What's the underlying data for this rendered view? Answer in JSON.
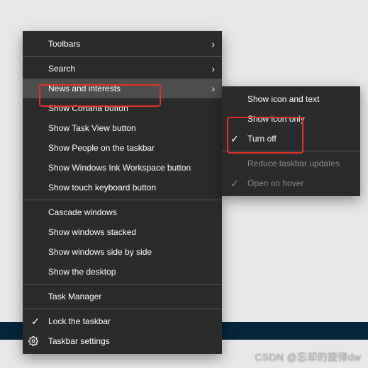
{
  "mainMenu": {
    "toolbars": "Toolbars",
    "search": "Search",
    "newsInterests": "News and interests",
    "showCortana": "Show Cortana button",
    "showTaskView": "Show Task View button",
    "showPeople": "Show People on the taskbar",
    "showInk": "Show Windows Ink Workspace button",
    "showTouchKb": "Show touch keyboard button",
    "cascade": "Cascade windows",
    "stacked": "Show windows stacked",
    "sideBySide": "Show windows side by side",
    "showDesktop": "Show the desktop",
    "taskManager": "Task Manager",
    "lockTaskbar": "Lock the taskbar",
    "taskbarSettings": "Taskbar settings"
  },
  "subMenu": {
    "iconText": "Show icon and text",
    "iconOnly": "Show icon only",
    "turnOff": "Turn off",
    "reduceUpdates": "Reduce taskbar updates",
    "openHover": "Open on hover"
  },
  "glyphs": {
    "arrow": "›",
    "check": "✓"
  },
  "watermark": "CSDN @忘却的旋律dw"
}
